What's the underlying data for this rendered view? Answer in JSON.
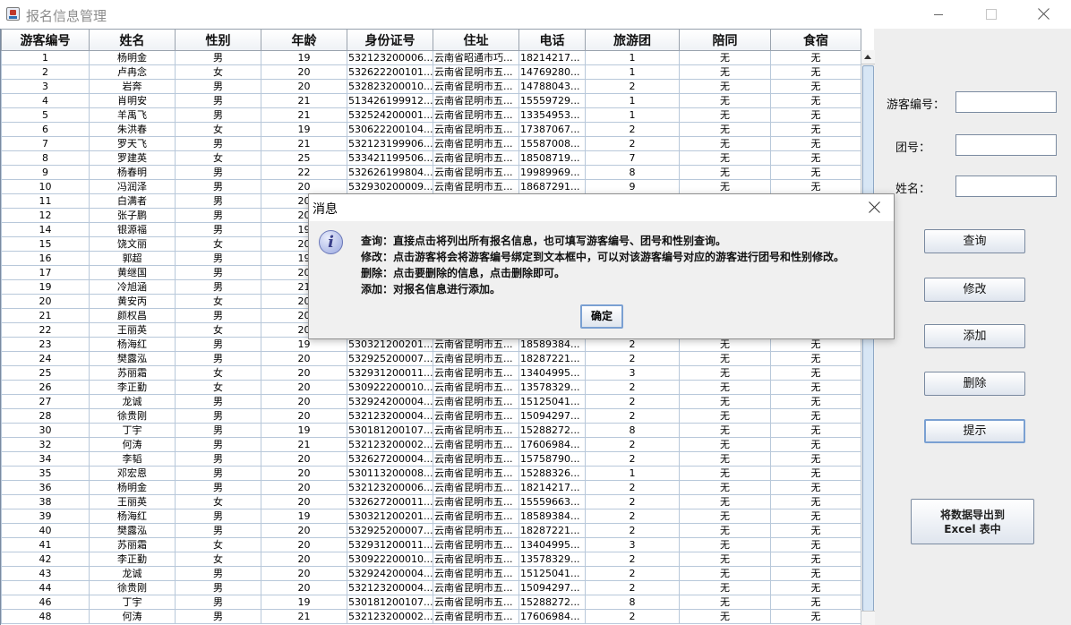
{
  "window": {
    "title": "报名信息管理"
  },
  "table": {
    "columns": [
      "游客编号",
      "姓名",
      "性别",
      "年龄",
      "身份证号",
      "住址",
      "电话",
      "旅游团",
      "陪同",
      "食宿"
    ],
    "rows": [
      [
        "1",
        "杨明金",
        "男",
        "19",
        "532123200006...",
        "云南省昭通市巧...",
        "18214217...",
        "1",
        "无",
        "无"
      ],
      [
        "2",
        "卢冉念",
        "女",
        "20",
        "532622200101...",
        "云南省昆明市五...",
        "14769280...",
        "1",
        "无",
        "无"
      ],
      [
        "3",
        "岩奔",
        "男",
        "20",
        "532823200010...",
        "云南省昆明市五...",
        "14788043...",
        "2",
        "无",
        "无"
      ],
      [
        "4",
        "肖明安",
        "男",
        "21",
        "513426199912...",
        "云南省昆明市五...",
        "15559729...",
        "1",
        "无",
        "无"
      ],
      [
        "5",
        "羊禹飞",
        "男",
        "21",
        "532524200001...",
        "云南省昆明市五...",
        "13354953...",
        "1",
        "无",
        "无"
      ],
      [
        "6",
        "朱洪春",
        "女",
        "19",
        "530622200104...",
        "云南省昆明市五...",
        "17387067...",
        "2",
        "无",
        "无"
      ],
      [
        "7",
        "罗天飞",
        "男",
        "21",
        "532123199906...",
        "云南省昆明市五...",
        "15587008...",
        "2",
        "无",
        "无"
      ],
      [
        "8",
        "罗建英",
        "女",
        "25",
        "533421199506...",
        "云南省昆明市五...",
        "18508719...",
        "7",
        "无",
        "无"
      ],
      [
        "9",
        "杨春明",
        "男",
        "22",
        "532626199804...",
        "云南省昆明市五...",
        "19989969...",
        "8",
        "无",
        "无"
      ],
      [
        "10",
        "冯润泽",
        "男",
        "20",
        "532930200009...",
        "云南省昆明市五...",
        "18687291...",
        "9",
        "无",
        "无"
      ],
      [
        "11",
        "白满者",
        "男",
        "20",
        "",
        "",
        "",
        "",
        "",
        ""
      ],
      [
        "12",
        "张子鹏",
        "男",
        "20",
        "",
        "",
        "",
        "",
        "",
        ""
      ],
      [
        "14",
        "银源福",
        "男",
        "19",
        "",
        "",
        "",
        "",
        "",
        ""
      ],
      [
        "15",
        "饶文丽",
        "女",
        "20",
        "",
        "",
        "",
        "",
        "",
        ""
      ],
      [
        "16",
        "郭超",
        "男",
        "19",
        "",
        "",
        "",
        "",
        "",
        ""
      ],
      [
        "17",
        "黄继国",
        "男",
        "20",
        "",
        "",
        "",
        "",
        "",
        ""
      ],
      [
        "19",
        "冷旭涵",
        "男",
        "21",
        "",
        "",
        "",
        "",
        "",
        ""
      ],
      [
        "20",
        "黄安丙",
        "女",
        "20",
        "",
        "",
        "",
        "",
        "",
        ""
      ],
      [
        "21",
        "颜权昌",
        "男",
        "20",
        "",
        "",
        "",
        "",
        "",
        ""
      ],
      [
        "22",
        "王丽英",
        "女",
        "20",
        "",
        "",
        "",
        "",
        "",
        ""
      ],
      [
        "23",
        "杨海红",
        "男",
        "19",
        "530321200201...",
        "云南省昆明市五...",
        "18589384...",
        "2",
        "无",
        "无"
      ],
      [
        "24",
        "樊露泓",
        "男",
        "20",
        "532925200007...",
        "云南省昆明市五...",
        "18287221...",
        "2",
        "无",
        "无"
      ],
      [
        "25",
        "苏丽霜",
        "女",
        "20",
        "532931200011...",
        "云南省昆明市五...",
        "13404995...",
        "3",
        "无",
        "无"
      ],
      [
        "26",
        "李正勤",
        "女",
        "20",
        "530922200010...",
        "云南省昆明市五...",
        "13578329...",
        "2",
        "无",
        "无"
      ],
      [
        "27",
        "龙诚",
        "男",
        "20",
        "532924200004...",
        "云南省昆明市五...",
        "15125041...",
        "2",
        "无",
        "无"
      ],
      [
        "28",
        "徐贵刚",
        "男",
        "20",
        "532123200004...",
        "云南省昆明市五...",
        "15094297...",
        "2",
        "无",
        "无"
      ],
      [
        "30",
        "丁宇",
        "男",
        "19",
        "530181200107...",
        "云南省昆明市五...",
        "15288272...",
        "8",
        "无",
        "无"
      ],
      [
        "32",
        "何涛",
        "男",
        "21",
        "532123200002...",
        "云南省昆明市五...",
        "17606984...",
        "2",
        "无",
        "无"
      ],
      [
        "34",
        "李韬",
        "男",
        "20",
        "532627200004...",
        "云南省昆明市五...",
        "15758790...",
        "2",
        "无",
        "无"
      ],
      [
        "35",
        "邓宏恩",
        "男",
        "20",
        "530113200008...",
        "云南省昆明市五...",
        "15288326...",
        "1",
        "无",
        "无"
      ],
      [
        "36",
        "杨明金",
        "男",
        "20",
        "532123200006...",
        "云南省昆明市五...",
        "18214217...",
        "2",
        "无",
        "无"
      ],
      [
        "38",
        "王丽英",
        "女",
        "20",
        "532627200011...",
        "云南省昆明市五...",
        "15559663...",
        "2",
        "无",
        "无"
      ],
      [
        "39",
        "杨海红",
        "男",
        "19",
        "530321200201...",
        "云南省昆明市五...",
        "18589384...",
        "2",
        "无",
        "无"
      ],
      [
        "40",
        "樊露泓",
        "男",
        "20",
        "532925200007...",
        "云南省昆明市五...",
        "18287221...",
        "2",
        "无",
        "无"
      ],
      [
        "41",
        "苏丽霜",
        "女",
        "20",
        "532931200011...",
        "云南省昆明市五...",
        "13404995...",
        "3",
        "无",
        "无"
      ],
      [
        "42",
        "李正勤",
        "女",
        "20",
        "530922200010...",
        "云南省昆明市五...",
        "13578329...",
        "2",
        "无",
        "无"
      ],
      [
        "43",
        "龙诚",
        "男",
        "20",
        "532924200004...",
        "云南省昆明市五...",
        "15125041...",
        "2",
        "无",
        "无"
      ],
      [
        "44",
        "徐贵刚",
        "男",
        "20",
        "532123200004...",
        "云南省昆明市五...",
        "15094297...",
        "2",
        "无",
        "无"
      ],
      [
        "46",
        "丁宇",
        "男",
        "19",
        "530181200107...",
        "云南省昆明市五...",
        "15288272...",
        "8",
        "无",
        "无"
      ],
      [
        "48",
        "何涛",
        "男",
        "21",
        "532123200002...",
        "云南省昆明市五...",
        "17606984...",
        "2",
        "无",
        "无"
      ]
    ]
  },
  "form": {
    "tourist_id_label": "游客编号：",
    "tourist_id_value": "",
    "group_label": "团号：",
    "group_value": "",
    "name_label": "姓名：",
    "name_value": ""
  },
  "buttons": {
    "query": "查询",
    "modify": "修改",
    "add": "添加",
    "delete": "删除",
    "hint": "提示",
    "export_line1": "将数据导出到",
    "export_line2": "Excel 表中"
  },
  "dialog": {
    "title": "消息",
    "icon": "info-icon",
    "lines": [
      "查询：直接点击将列出所有报名信息，也可填写游客编号、团号和性别查询。",
      "修改：点击游客将会将游客编号绑定到文本框中，可以对该游客编号对应的游客进行团号和性别修改。",
      "删除：点击要删除的信息，点击删除即可。",
      "添加：对报名信息进行添加。"
    ],
    "ok": "确定"
  }
}
